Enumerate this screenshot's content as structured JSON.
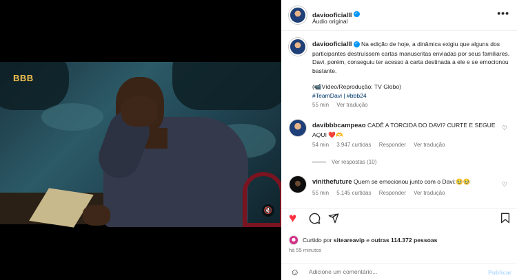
{
  "post": {
    "username": "daviooficialll",
    "audio": "Áudio original",
    "caption": "Na edição de hoje, a dinâmica exigiu que alguns dos participantes destruíssem cartas manuscritas enviadas por seus familiares. Davi, porém, conseguiu ter acesso à carta destinada a ele e se emocionou bastante.",
    "credit": "(📹Vídeo/Reprodução: TV Globo)",
    "tags": "#TeamDavi | #bbb24",
    "time": "55 min",
    "see_translation": "Ver tradução"
  },
  "video": {
    "logo": "BBB",
    "mute_icon": "🔇"
  },
  "comments": [
    {
      "username": "davibbbcampeao",
      "text": "CADÊ A TORCIDA DO DAVI? CURTE E SEGUE AQUI ❤️🫶",
      "time": "54 min",
      "likes": "3.947 curtidas",
      "reply": "Responder",
      "translate": "Ver tradução",
      "view_replies": "Ver respostas (10)"
    },
    {
      "username": "vinithefuture",
      "text": "Quem se emocionou junto com o Davi:🥹🥹",
      "time": "55 min",
      "likes": "5.145 curtidas",
      "reply": "Responder",
      "translate": "Ver tradução"
    }
  ],
  "actions": {
    "like_icon": "♥",
    "comment_icon": "◯",
    "share_icon": "➤",
    "save_icon": "▯"
  },
  "likes": {
    "prefix": "Curtido por",
    "user": "siteareavip",
    "middle": "e",
    "others": "outras 114.372 pessoas"
  },
  "time_ago": "há 55 minutos",
  "add_comment": {
    "placeholder": "Adicione um comentário...",
    "publish": "Publicar",
    "emoji_icon": "☺"
  },
  "more_icon": "•••",
  "heart_icon": "♡",
  "colors": {
    "accent": "#0095f6",
    "like": "#ff3040",
    "link": "#00376b"
  }
}
